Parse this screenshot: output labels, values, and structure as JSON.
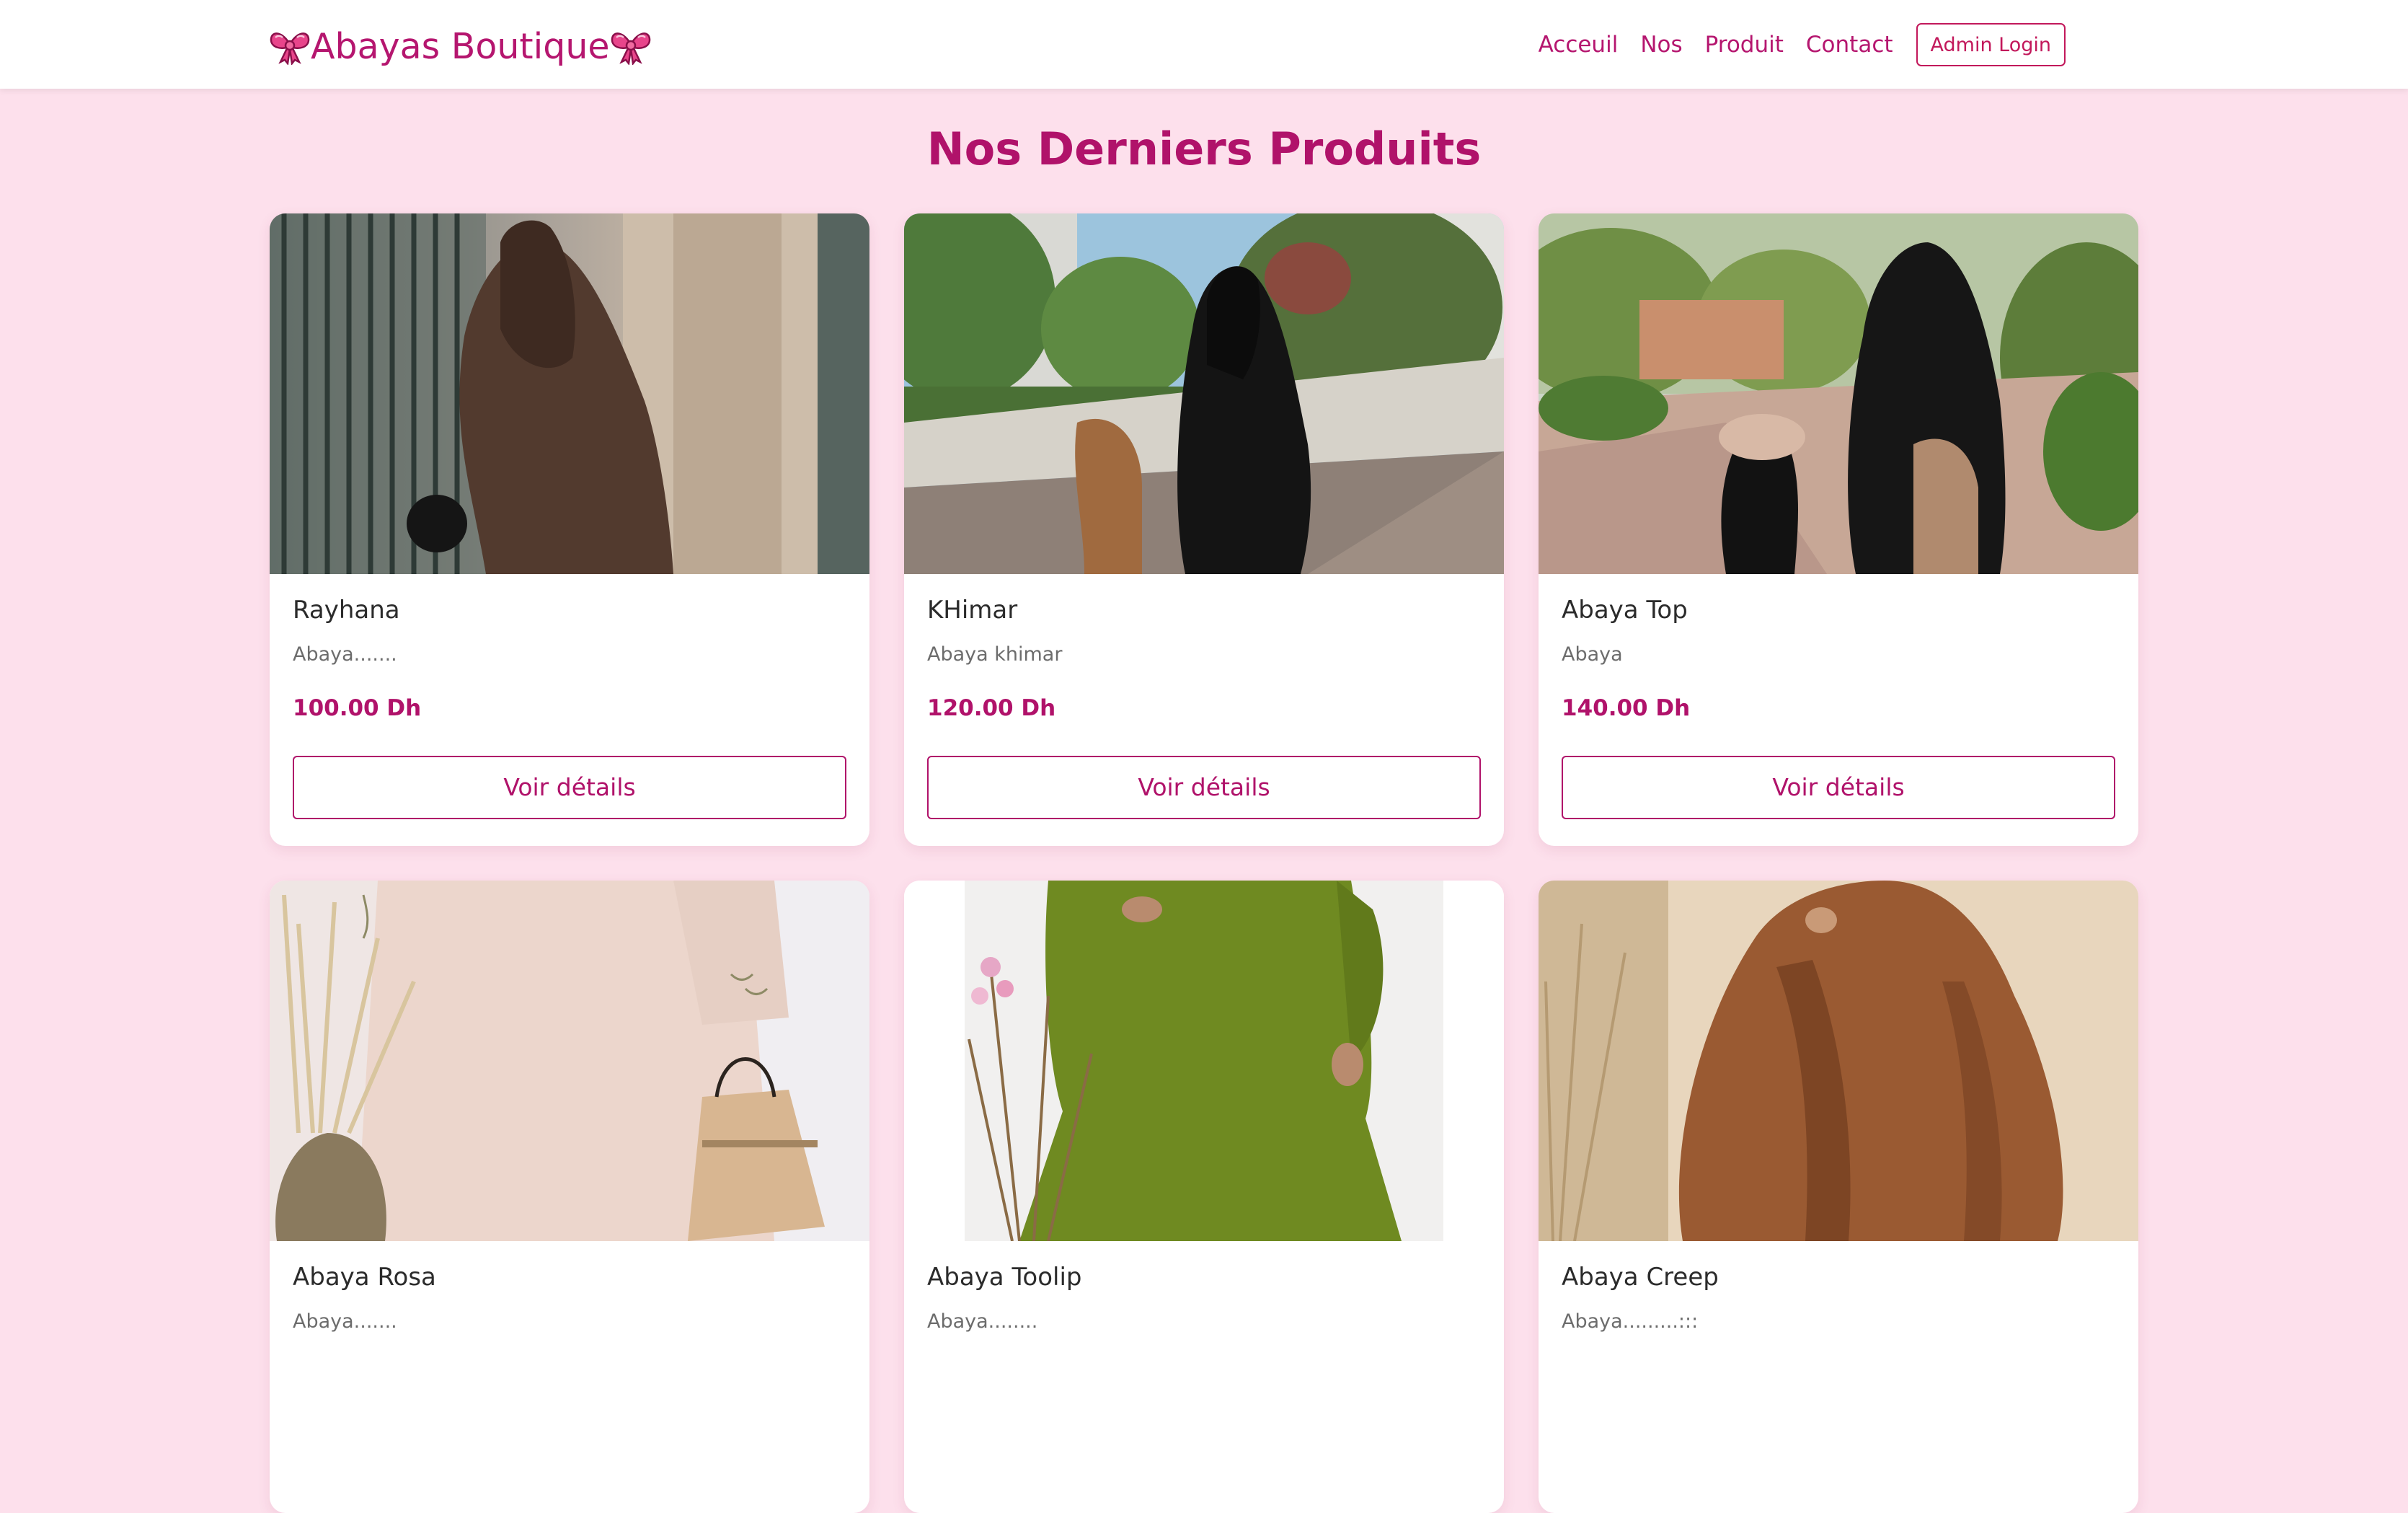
{
  "header": {
    "brand": "Abayas Boutique",
    "nav": [
      "Acceuil",
      "Nos",
      "Produit",
      "Contact"
    ],
    "admin_login": "Admin Login"
  },
  "main": {
    "title": "Nos Derniers Produits",
    "products": [
      {
        "name": "Rayhana",
        "description": "Abaya.......",
        "price": "100.00 Dh",
        "button": "Voir détails"
      },
      {
        "name": "KHimar",
        "description": "Abaya khimar",
        "price": "120.00 Dh",
        "button": "Voir détails"
      },
      {
        "name": "Abaya Top",
        "description": "Abaya",
        "price": "140.00 Dh",
        "button": "Voir détails"
      },
      {
        "name": "Abaya Rosa",
        "description": "Abaya.......",
        "price": "",
        "button": ""
      },
      {
        "name": "Abaya Toolip",
        "description": "Abaya........",
        "price": "",
        "button": ""
      },
      {
        "name": "Abaya Creep",
        "description": "Abaya.........:::",
        "price": "",
        "button": ""
      }
    ]
  },
  "colors": {
    "accent": "#b0126a",
    "page_background": "#fde0ec",
    "card_background": "#ffffff"
  },
  "icons": {
    "brand_left": "pink-bow-icon",
    "brand_right": "pink-bow-icon"
  }
}
